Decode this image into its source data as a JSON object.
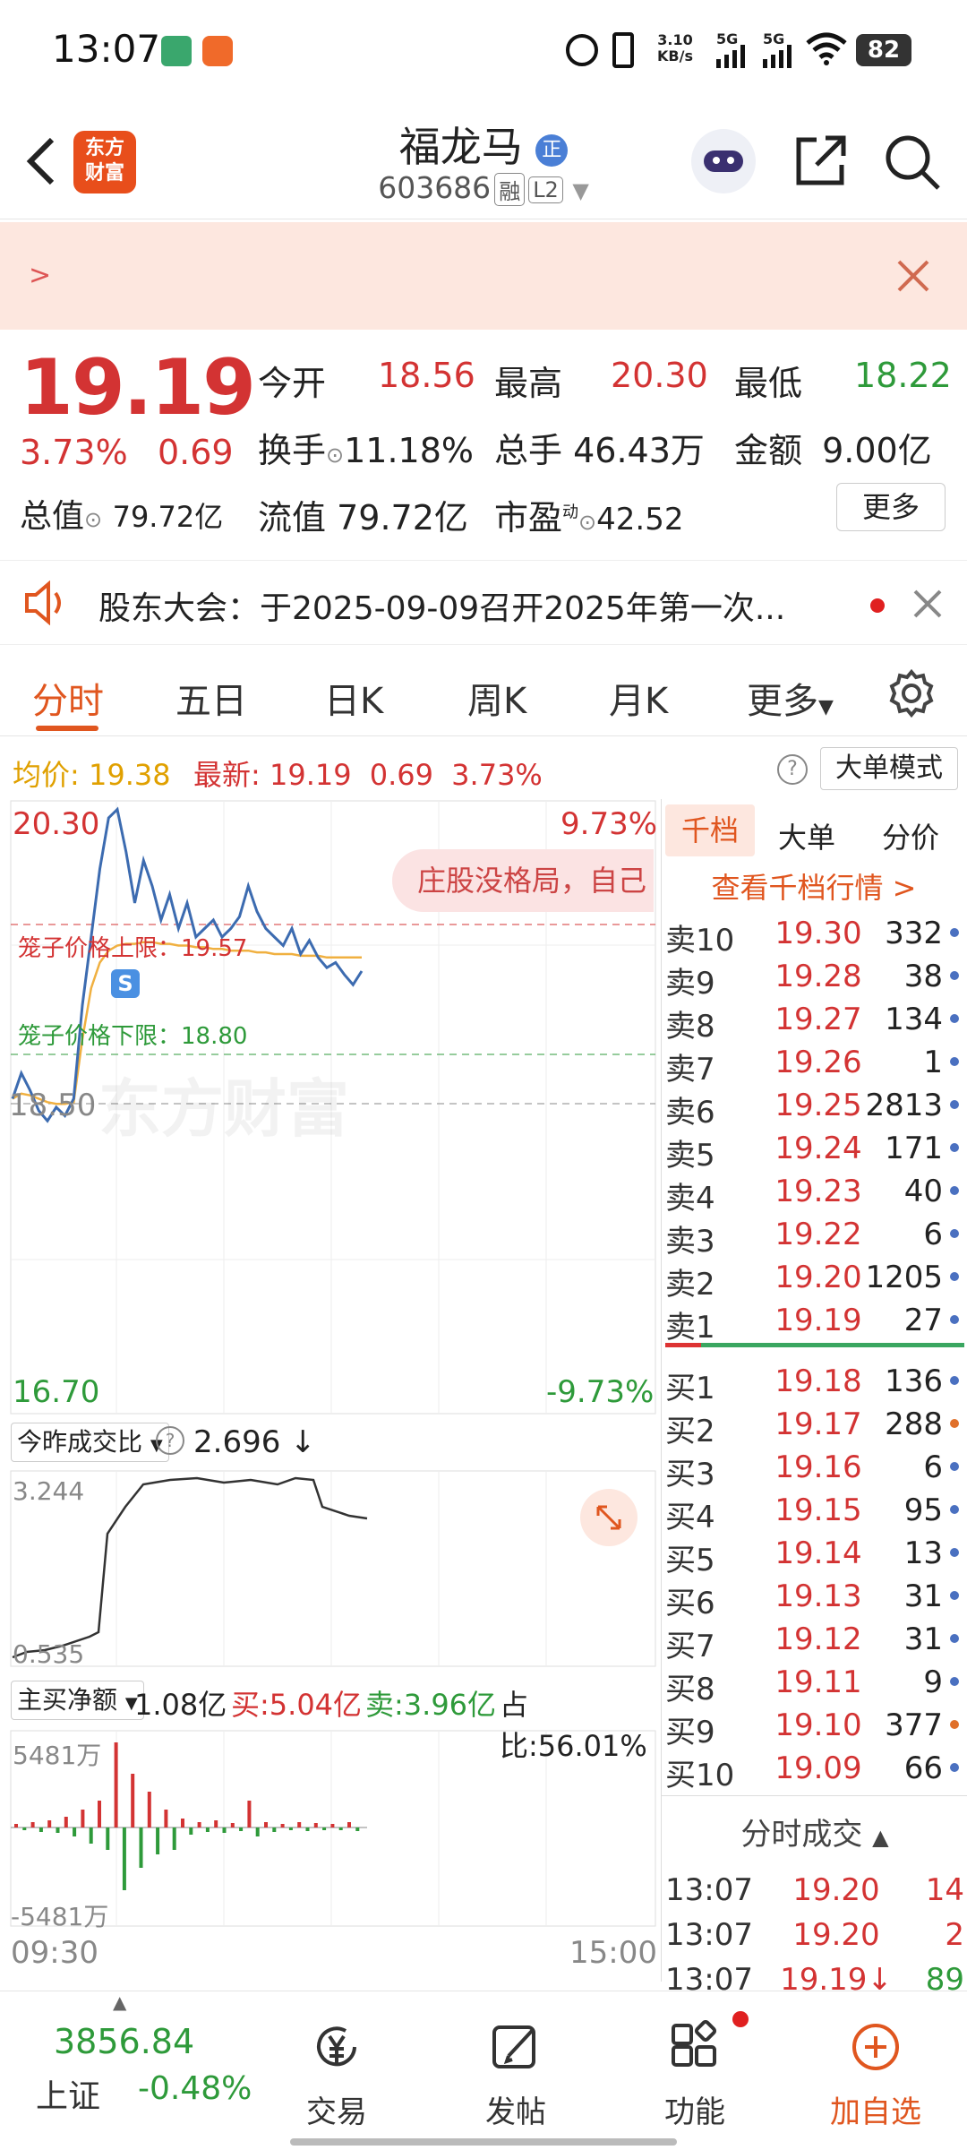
{
  "status_bar": {
    "time": "13:07",
    "net_speed_top": "3.10",
    "net_speed_bottom": "KB/s",
    "signal1": "5G",
    "signal2": "5G",
    "battery": "82"
  },
  "header": {
    "logo_text_1": "东方",
    "logo_text_2": "财富",
    "stock_name": "福龙马",
    "name_badge": "正",
    "stock_code": "603686",
    "tag_margin": "融",
    "tag_level": "L2"
  },
  "banner": {
    "text": ">"
  },
  "quote": {
    "price": "19.19",
    "change_pct": "3.73%",
    "change": "0.69",
    "open_label": "今开",
    "open": "18.56",
    "high_label": "最高",
    "high": "20.30",
    "low_label": "最低",
    "low": "18.22",
    "turnover_label": "换手",
    "turnover": "11.18%",
    "volume_label": "总手",
    "volume": "46.43万",
    "amount_label": "金额",
    "amount": "9.00亿",
    "mktcap_label": "总值",
    "mktcap": "79.72亿",
    "float_label": "流值",
    "float_cap": "79.72亿",
    "pe_label": "市盈",
    "pe_sup": "动",
    "pe": "42.52",
    "more_label": "更多"
  },
  "notice": {
    "text": "股东大会：于2025-09-09召开2025年第一次..."
  },
  "tabs": [
    "分时",
    "五日",
    "日K",
    "周K",
    "月K",
    "更多"
  ],
  "info_line": {
    "avg_label": "均价:",
    "avg": "19.38",
    "latest_label": "最新:",
    "latest": "19.19",
    "change": "0.69",
    "change_pct": "3.73%",
    "mode_button": "大单模式"
  },
  "chart": {
    "top_price": "20.30",
    "top_pct": "9.73%",
    "bottom_price": "16.70",
    "bottom_pct": "-9.73%",
    "mid_price": "18.50",
    "cage_upper": "笼子价格上限：19.57",
    "cage_lower": "笼子价格下限：18.80",
    "watermark": "东方财富",
    "marker_s": "S",
    "toast": "庄股没格局，自己",
    "ratio_select": "今昨成交比",
    "ratio_value": "2.696 ↓",
    "ratio_top": "3.244",
    "ratio_bottom": "0.535",
    "net_select": "主买净额",
    "net_value": "1.08亿",
    "net_buy": "买:5.04亿",
    "net_sell": "卖:3.96亿",
    "net_ratio": "占比:56.01%",
    "net_top": "5481万",
    "net_bottom": "-5481万",
    "time_start": "09:30",
    "time_end": "15:00"
  },
  "chart_data": {
    "type": "line",
    "price_axis": {
      "min": 16.7,
      "max": 20.3,
      "prev_close": 18.5
    },
    "price": [
      18.55,
      18.7,
      18.6,
      18.48,
      18.42,
      18.5,
      18.45,
      18.55,
      19.1,
      19.5,
      19.9,
      20.2,
      20.25,
      20.0,
      19.7,
      19.95,
      19.8,
      19.6,
      19.75,
      19.55,
      19.7,
      19.5,
      19.55,
      19.6,
      19.5,
      19.55,
      19.62,
      19.8,
      19.65,
      19.55,
      19.5,
      19.45,
      19.55,
      19.4,
      19.48,
      19.38,
      19.32,
      19.35,
      19.28,
      19.22,
      19.3
    ],
    "avg": [
      18.55,
      18.58,
      18.57,
      18.55,
      18.53,
      18.52,
      18.52,
      18.53,
      18.9,
      19.2,
      19.35,
      19.42,
      19.45,
      19.46,
      19.46,
      19.47,
      19.47,
      19.46,
      19.46,
      19.45,
      19.45,
      19.44,
      19.44,
      19.43,
      19.43,
      19.42,
      19.42,
      19.42,
      19.41,
      19.41,
      19.4,
      19.4,
      19.4,
      19.39,
      19.39,
      19.39,
      19.38,
      19.38,
      19.38,
      19.38,
      19.38
    ]
  },
  "order_book": {
    "tabs": [
      "千档",
      "大单",
      "分价"
    ],
    "link": "查看千档行情 >",
    "asks": [
      {
        "label": "卖10",
        "price": "19.30",
        "vol": "332"
      },
      {
        "label": "卖9",
        "price": "19.28",
        "vol": "38"
      },
      {
        "label": "卖8",
        "price": "19.27",
        "vol": "134"
      },
      {
        "label": "卖7",
        "price": "19.26",
        "vol": "1"
      },
      {
        "label": "卖6",
        "price": "19.25",
        "vol": "2813"
      },
      {
        "label": "卖5",
        "price": "19.24",
        "vol": "171"
      },
      {
        "label": "卖4",
        "price": "19.23",
        "vol": "40"
      },
      {
        "label": "卖3",
        "price": "19.22",
        "vol": "6"
      },
      {
        "label": "卖2",
        "price": "19.20",
        "vol": "1205"
      },
      {
        "label": "卖1",
        "price": "19.19",
        "vol": "27"
      }
    ],
    "bids": [
      {
        "label": "买1",
        "price": "19.18",
        "vol": "136"
      },
      {
        "label": "买2",
        "price": "19.17",
        "vol": "288"
      },
      {
        "label": "买3",
        "price": "19.16",
        "vol": "6"
      },
      {
        "label": "买4",
        "price": "19.15",
        "vol": "95"
      },
      {
        "label": "买5",
        "price": "19.14",
        "vol": "13"
      },
      {
        "label": "买6",
        "price": "19.13",
        "vol": "31"
      },
      {
        "label": "买7",
        "price": "19.12",
        "vol": "31"
      },
      {
        "label": "买8",
        "price": "19.11",
        "vol": "9"
      },
      {
        "label": "买9",
        "price": "19.10",
        "vol": "377"
      },
      {
        "label": "买10",
        "price": "19.09",
        "vol": "66"
      }
    ],
    "trades_title": "分时成交",
    "trades": [
      {
        "time": "13:07",
        "price": "19.20",
        "vol": "14"
      },
      {
        "time": "13:07",
        "price": "19.20",
        "vol": "2"
      },
      {
        "time": "13:07",
        "price": "19.19↓",
        "vol": "89"
      }
    ]
  },
  "bottom_nav": {
    "index_value": "3856.84",
    "index_name": "上证",
    "index_change": "-0.48%",
    "trade": "交易",
    "post": "发帖",
    "function": "功能",
    "add": "加自选"
  },
  "colors": {
    "up": "#d33333",
    "down": "#2e9a3a",
    "accent": "#e0561f",
    "line": "#3c6bb0",
    "avg": "#f0b040"
  }
}
